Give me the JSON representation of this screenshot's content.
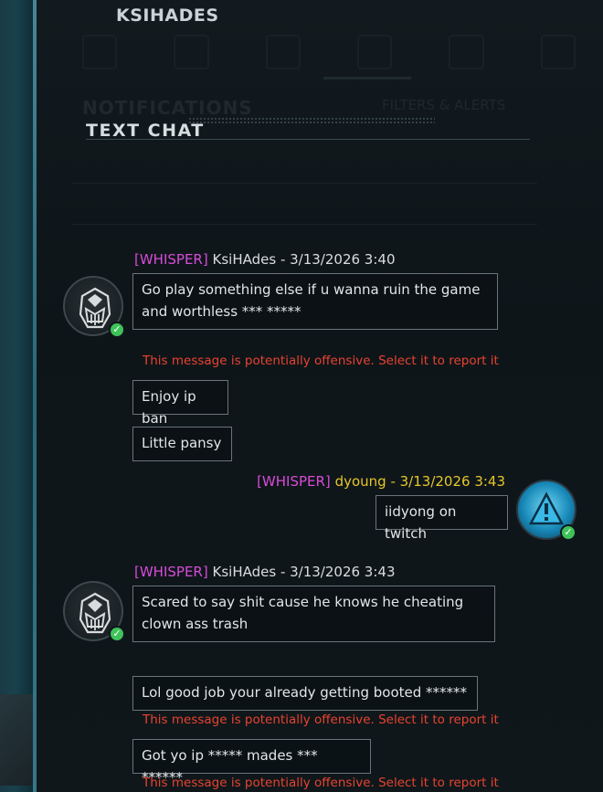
{
  "window": {
    "title": "KSIHADES"
  },
  "background": {
    "notifications_title": "NOTIFICATIONS",
    "filters_label": "FILTERS & ALERTS"
  },
  "chat": {
    "title": "TEXT CHAT"
  },
  "warning_text": "This message is potentially offensive. Select it to report it",
  "messages": [
    {
      "tag": "[WHISPER]",
      "sender": "KsiHAdes",
      "timestamp": " - 3/13/2026 3:40",
      "lines": [
        "Go play something else  if u wanna  ruin the game  and worthless *** *****",
        "Enjoy ip ban",
        "Little  pansy"
      ]
    },
    {
      "tag": "[WHISPER]",
      "sender": "dyoung",
      "timestamp": " - 3/13/2026 3:43",
      "lines": [
        "iidyong on twitch"
      ]
    },
    {
      "tag": "[WHISPER]",
      "sender": "KsiHAdes",
      "timestamp": " - 3/13/2026 3:43",
      "lines": [
        "Scared  to say shit cause  he knows  he cheating  clown ass trash",
        "Lol good job your  already getting  booted ******",
        "Got yo ip ***** mades *** ******"
      ]
    }
  ],
  "colors": {
    "whisper_tag": "#d84bd8",
    "self_name": "#e6c62a",
    "warning": "#e8432f",
    "online": "#3fc25a"
  },
  "icons": {
    "avatar_other": "helmet-emblem-icon",
    "avatar_self": "warning-triangle-icon",
    "status": "online-check-icon"
  }
}
